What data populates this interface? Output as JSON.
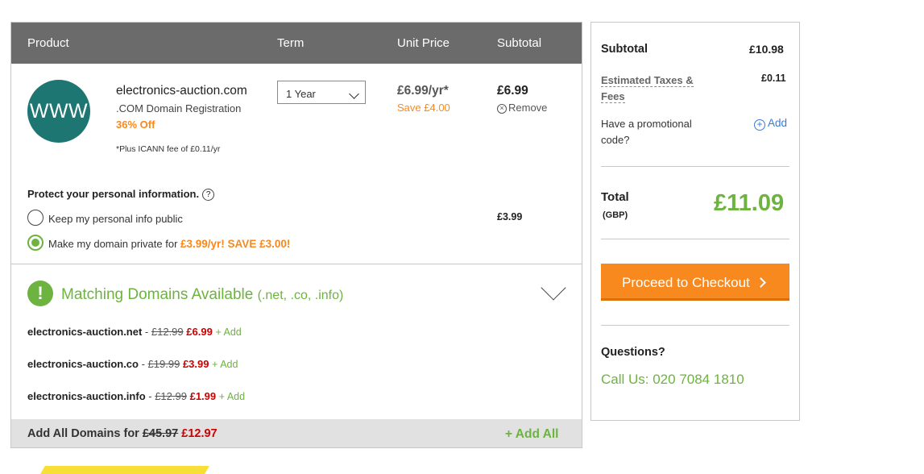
{
  "table": {
    "headers": {
      "product": "Product",
      "term": "Term",
      "unit_price": "Unit Price",
      "subtotal": "Subtotal"
    }
  },
  "item": {
    "logo_text": "WWW",
    "domain": "electronics-auction.com",
    "type": ".COM Domain Registration",
    "discount": "36% Off",
    "fee_note": "*Plus ICANN fee of £0.11/yr",
    "term": "1 Year",
    "unit_price": "£6.99/yr*",
    "save": "Save £4.00",
    "subtotal": "£6.99",
    "remove": "Remove"
  },
  "privacy": {
    "heading": "Protect your personal information.",
    "help": "?",
    "option_public": "Keep my personal info public",
    "option_private_prefix": "Make my domain private for ",
    "option_private_offer": "£3.99/yr! SAVE £3.00!",
    "price": "£3.99",
    "selected": "private"
  },
  "matching": {
    "icon": "!",
    "title": "Matching Domains Available",
    "tlds": "(.net, .co, .info)",
    "domains": [
      {
        "name": "electronics-auction.net",
        "separator": " - ",
        "old_price": "£12.99",
        "new_price": "£6.99",
        "add": "+ Add"
      },
      {
        "name": "electronics-auction.co",
        "separator": " - ",
        "old_price": "£19.99",
        "new_price": "£3.99",
        "add": "+ Add"
      },
      {
        "name": "electronics-auction.info",
        "separator": " - ",
        "old_price": "£12.99",
        "new_price": "£1.99",
        "add": "+ Add"
      }
    ],
    "add_all_label": "Add All Domains for ",
    "add_all_old": "£45.97",
    "add_all_new": "£12.97",
    "add_all_button": "+ Add All"
  },
  "summary": {
    "subtotal_label": "Subtotal",
    "subtotal_value": "£10.98",
    "taxes_label_1": "Estimated Taxes &",
    "taxes_label_2": "Fees",
    "taxes_value": "£0.11",
    "promo_label_1": "Have a promotional",
    "promo_label_2": "code?",
    "promo_add": "Add",
    "total_label": "Total",
    "currency": "(GBP)",
    "total_value": "£11.09",
    "checkout": "Proceed to Checkout",
    "questions": "Questions?",
    "call_us": "Call Us: 020 7084 1810"
  },
  "colors": {
    "header_bg": "#6b6b6b",
    "brand_green": "#6db33f",
    "orange": "#f7891f",
    "sale_red": "#cc0000",
    "logo_teal": "#1e7673",
    "link_blue": "#3a7bd5"
  }
}
